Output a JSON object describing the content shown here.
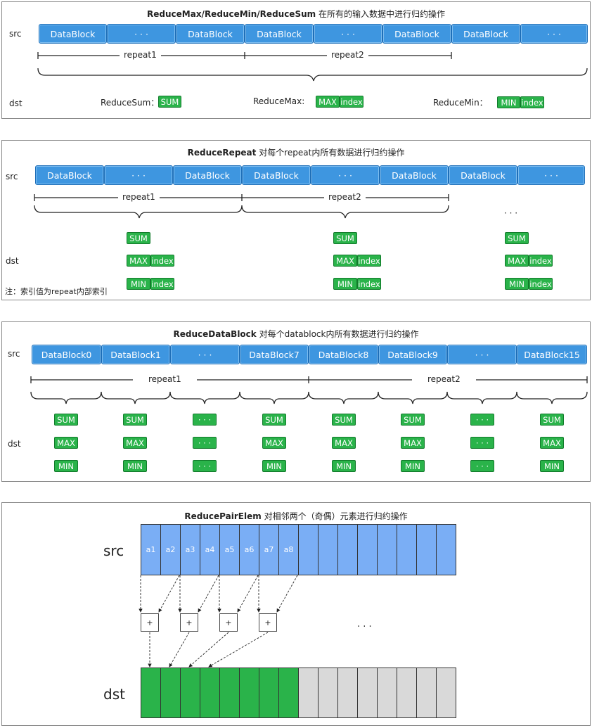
{
  "panel1": {
    "title_bold": "ReduceMax/ReduceMin/ReduceSum",
    "title_rest": " 在所有的输入数据中进行归约操作",
    "src_label": "src",
    "dst_label": "dst",
    "blocks": [
      "DataBlock",
      "· · ·",
      "DataBlock",
      "DataBlock",
      "· · ·",
      "DataBlock",
      "DataBlock",
      "· · ·"
    ],
    "repeat1": "repeat1",
    "repeat2": "repeat2",
    "sum_label": "ReduceSum：",
    "max_label": "ReduceMax:",
    "min_label": "ReduceMin：",
    "sum": "SUM",
    "max": "MAX",
    "min": "MIN",
    "index": "index"
  },
  "panel2": {
    "title_bold": "ReduceRepeat",
    "title_rest": "  对每个repeat内所有数据进行归约操作",
    "src_label": "src",
    "dst_label": "dst",
    "blocks": [
      "DataBlock",
      "· · ·",
      "DataBlock",
      "DataBlock",
      "· · ·",
      "DataBlock",
      "DataBlock",
      "· · ·"
    ],
    "repeat1": "repeat1",
    "repeat2": "repeat2",
    "dots": "· · ·",
    "sum": "SUM",
    "max": "MAX",
    "min": "MIN",
    "index": "index",
    "note": "注：索引值为repeat内部索引"
  },
  "panel3": {
    "title_bold": "ReduceDataBlock",
    "title_rest": " 对每个datablock内所有数据进行归约操作",
    "src_label": "src",
    "dst_label": "dst",
    "blocks": [
      "DataBlock0",
      "DataBlock1",
      "· · ·",
      "DataBlock7",
      "DataBlock8",
      "DataBlock9",
      "· · ·",
      "DataBlock15"
    ],
    "repeat1": "repeat1",
    "repeat2": "repeat2",
    "sum": "SUM",
    "max": "MAX",
    "min": "MIN",
    "dots": "· · ·"
  },
  "panel4": {
    "title_bold": "ReducePairElem",
    "title_rest": " 对相邻两个（奇偶）元素进行归约操作",
    "src_label": "src",
    "dst_label": "dst",
    "cells": [
      "a1",
      "a2",
      "a3",
      "a4",
      "a5",
      "a6",
      "a7",
      "a8"
    ],
    "plus": "+",
    "dots": ". . .",
    "colors": {
      "src": "#7aaef5",
      "dst_green": "#2ab34a",
      "dst_gray": "#d9d9d9"
    }
  }
}
